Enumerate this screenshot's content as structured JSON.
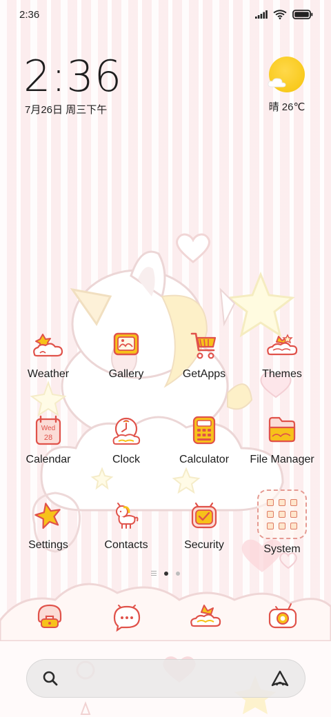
{
  "status_bar": {
    "time": "2:36",
    "icons": [
      "signal-icon",
      "wifi-icon",
      "battery-icon"
    ]
  },
  "clock_widget": {
    "time": "2:36",
    "date": "7月26日 周三下午"
  },
  "weather_widget": {
    "icon": "sun-cloud-icon",
    "temperature": "晴 26℃"
  },
  "apps": [
    {
      "label": "Weather",
      "icon": "weather-icon"
    },
    {
      "label": "Gallery",
      "icon": "gallery-icon"
    },
    {
      "label": "GetApps",
      "icon": "shopping-cart-icon"
    },
    {
      "label": "Themes",
      "icon": "themes-icon"
    },
    {
      "label": "Calendar",
      "icon": "calendar-icon",
      "badge_day": "Wed",
      "badge_date": "28"
    },
    {
      "label": "Clock",
      "icon": "clock-icon"
    },
    {
      "label": "Calculator",
      "icon": "calculator-icon"
    },
    {
      "label": "File Manager",
      "icon": "folder-icon"
    },
    {
      "label": "Settings",
      "icon": "star-icon"
    },
    {
      "label": "Contacts",
      "icon": "unicorn-icon"
    },
    {
      "label": "Security",
      "icon": "security-icon"
    },
    {
      "label": "System",
      "icon": "folder-group-icon"
    }
  ],
  "page_indicator": {
    "pages": 2,
    "active": 1
  },
  "dock": [
    {
      "icon": "phone-icon"
    },
    {
      "icon": "messages-icon"
    },
    {
      "icon": "browser-icon"
    },
    {
      "icon": "camera-icon"
    }
  ],
  "search_bar": {
    "search_icon": "search-icon",
    "assistant_icon": "assistant-icon"
  },
  "colors": {
    "accent_red": "#e0524a",
    "accent_yellow": "#f7c21a",
    "wallpaper_pink": "#fce8ea"
  }
}
